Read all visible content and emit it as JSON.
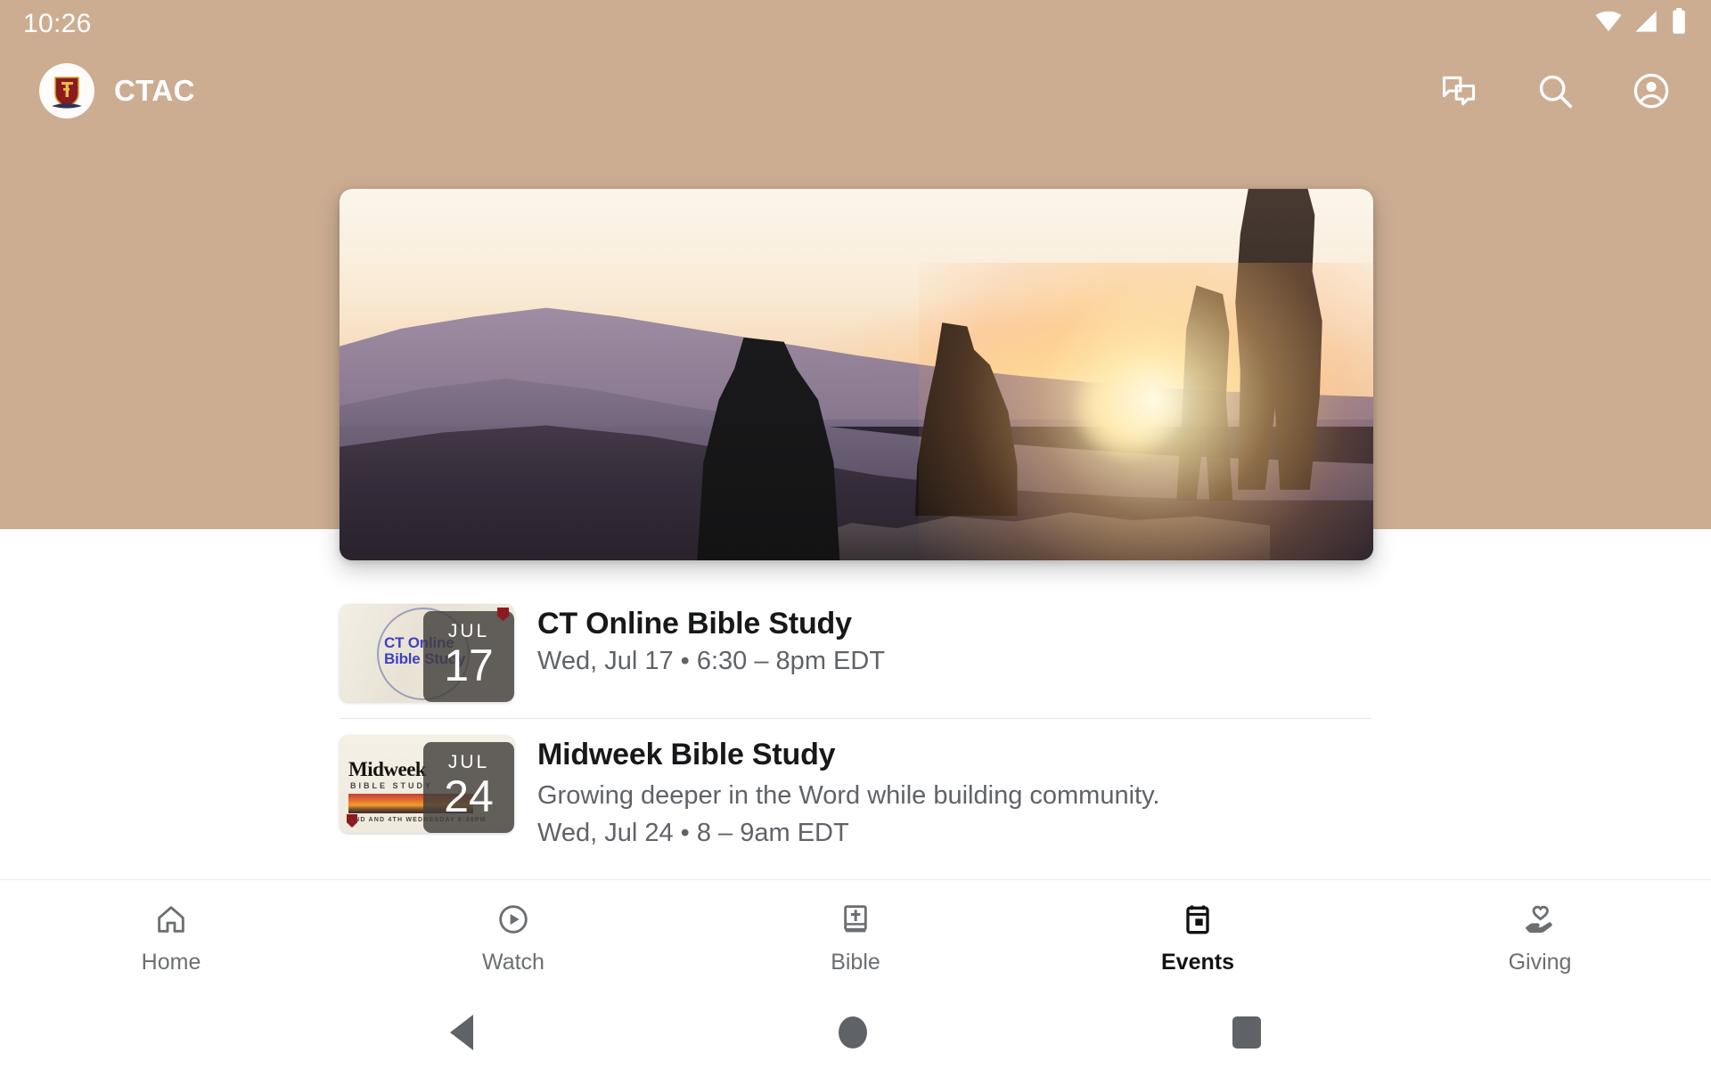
{
  "status_bar": {
    "time": "10:26",
    "icons": [
      "wifi-icon",
      "cellular-signal-icon",
      "battery-icon"
    ]
  },
  "app_bar": {
    "logo_alt": "ctac-crest-logo",
    "title": "CTAC",
    "actions": [
      {
        "name": "chat-icon",
        "label": "Chat"
      },
      {
        "name": "search-icon",
        "label": "Search"
      },
      {
        "name": "account-circle-icon",
        "label": "Account"
      }
    ],
    "background_color": "#CCAD92"
  },
  "hero": {
    "name": "featured-banner-image",
    "alt": "People watching a sunrise from a mountain ridge"
  },
  "events": [
    {
      "title": "CT Online Bible Study",
      "description": "",
      "meta": "Wed, Jul 17 • 6:30 – 8pm EDT",
      "badge_month": "JUL",
      "badge_day": "17",
      "thumb_text_line1": "CT Online",
      "thumb_text_line2": "Bible Study"
    },
    {
      "title": "Midweek Bible Study",
      "description": "Growing deeper in the Word while building community.",
      "meta": "Wed, Jul 24 • 8 – 9am EDT",
      "badge_month": "JUL",
      "badge_day": "24",
      "thumb_text_line1": "Midweek",
      "thumb_text_line2": "BIBLE STUDY",
      "thumb_text_line3": "2ND AND 4TH WEDNESDAY 6:30PM"
    }
  ],
  "bottom_nav": {
    "active": "Events",
    "items": [
      {
        "label": "Home",
        "icon": "home-icon",
        "active": false
      },
      {
        "label": "Watch",
        "icon": "play-circle-icon",
        "active": false
      },
      {
        "label": "Bible",
        "icon": "bible-book-icon",
        "active": false
      },
      {
        "label": "Events",
        "icon": "calendar-icon",
        "active": true
      },
      {
        "label": "Giving",
        "icon": "hand-heart-icon",
        "active": false
      }
    ]
  },
  "system_nav": {
    "back": "back-triangle-icon",
    "home": "home-circle-icon",
    "recents": "recents-square-icon"
  }
}
